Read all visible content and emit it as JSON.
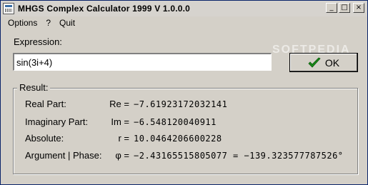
{
  "window": {
    "title": "MHGS Complex Calculator 1999   V 1.0.0.0",
    "controls": {
      "minimize": "_",
      "maximize": "□",
      "close": "×"
    }
  },
  "menu": {
    "items": [
      "Options",
      "?",
      "Quit"
    ]
  },
  "expression": {
    "label": "Expression:",
    "value": "sin(3i+4)"
  },
  "ok_button": {
    "label": "OK",
    "icon": "check-icon"
  },
  "watermark": "SOFTPEDIA",
  "result": {
    "title": "Result:",
    "rows": [
      {
        "label": "Real Part:",
        "symbol": "Re =",
        "value": "−7.61923172032141"
      },
      {
        "label": "Imaginary Part:",
        "symbol": "Im =",
        "value": "−6.548120040911"
      },
      {
        "label": "Absolute:",
        "symbol": "r =",
        "value": "10.0464206600228"
      },
      {
        "label": "Argument | Phase:",
        "symbol": "φ =",
        "value": "−2.43165515805077 = −139.323577787526°"
      }
    ]
  },
  "colors": {
    "face": "#d4d0c8",
    "check": "#1a8a1a"
  }
}
